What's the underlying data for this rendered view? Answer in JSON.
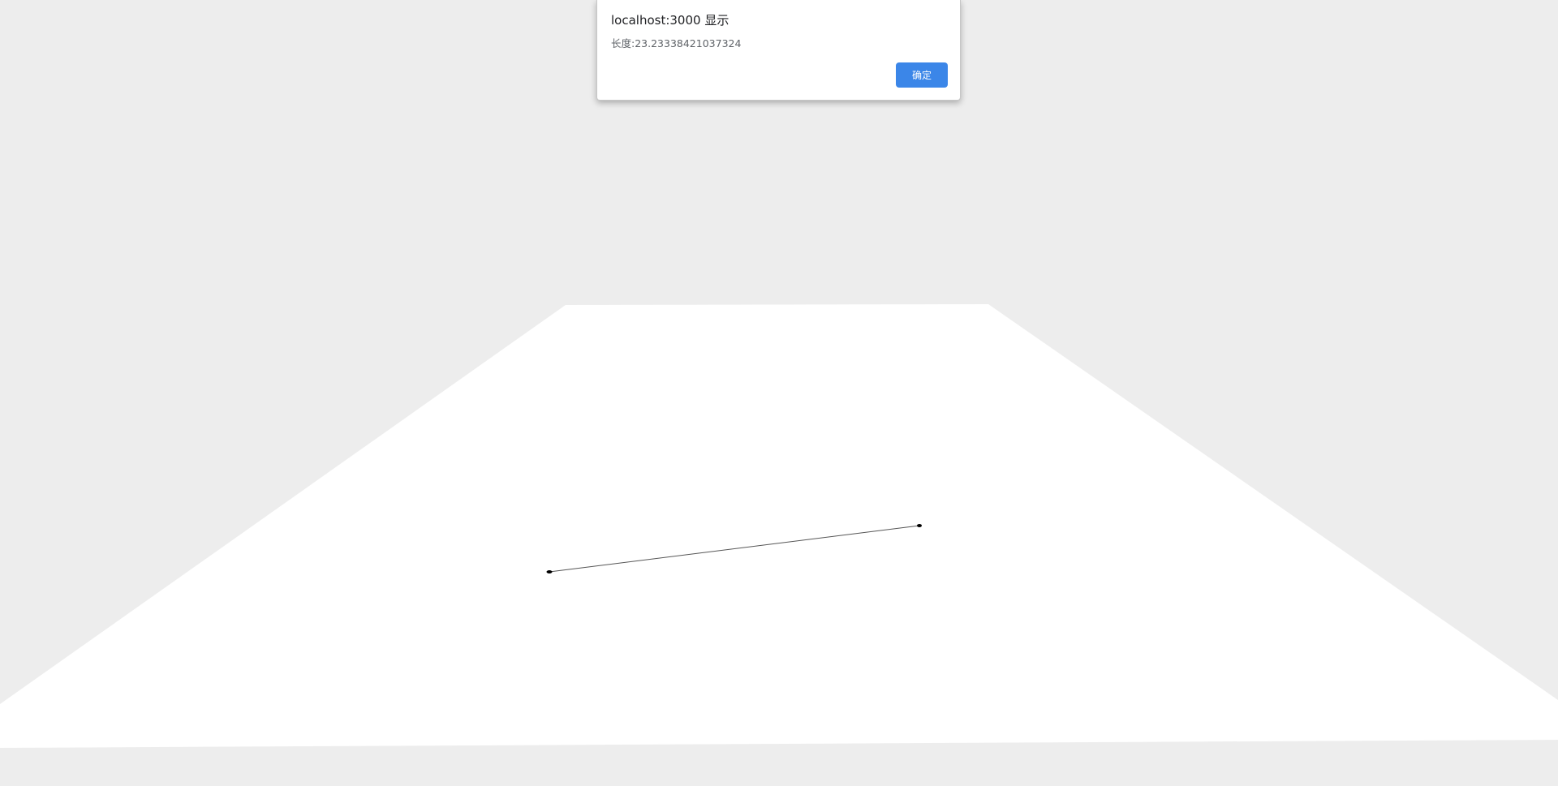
{
  "dialog": {
    "title": "localhost:3000 显示",
    "message": "长度:23.23338421037324",
    "ok_label": "确定"
  },
  "colors": {
    "background": "#ededed",
    "plane": "#ffffff",
    "measure_line": "#555555",
    "measure_point": "#000000",
    "button": "#3b86e8"
  }
}
